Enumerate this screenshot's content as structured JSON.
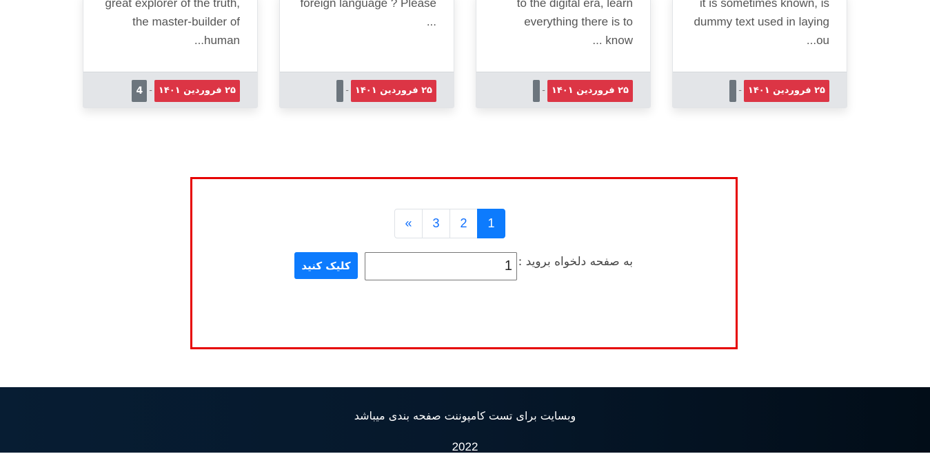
{
  "cards": [
    {
      "lines": [
        "great explorer of the truth,",
        "the master-builder of",
        "...human"
      ],
      "date": "۲۵ فروردین ۱۴۰۱",
      "count": "4"
    },
    {
      "lines": [
        "foreign language ? Please",
        "...",
        ""
      ],
      "date": "۲۵ فروردین ۱۴۰۱",
      "count": ""
    },
    {
      "lines": [
        "to the digital era, learn",
        "everything there is to",
        "... know"
      ],
      "date": "۲۵ فروردین ۱۴۰۱",
      "count": ""
    },
    {
      "lines": [
        "it is sometimes known, is",
        "dummy text used in laying",
        "...ou"
      ],
      "date": "۲۵ فروردین ۱۴۰۱",
      "count": ""
    }
  ],
  "separator": "-",
  "pagination": {
    "prev": "«",
    "pages": [
      "3",
      "2",
      "1"
    ],
    "active_page": "1"
  },
  "goto": {
    "label": "به صفحه دلخواه بروید :",
    "input_value": "1",
    "button_label": "کلیک کنید"
  },
  "footer": {
    "text": "وبسایت برای تست کامپوننت صفحه بندی میباشد",
    "year": "2022"
  },
  "colors": {
    "accent": "#0d7bfd",
    "badge_date": "#dc3545",
    "badge_count": "#6c757d",
    "highlight": "#e60000",
    "footer_bg": "#071d33"
  }
}
